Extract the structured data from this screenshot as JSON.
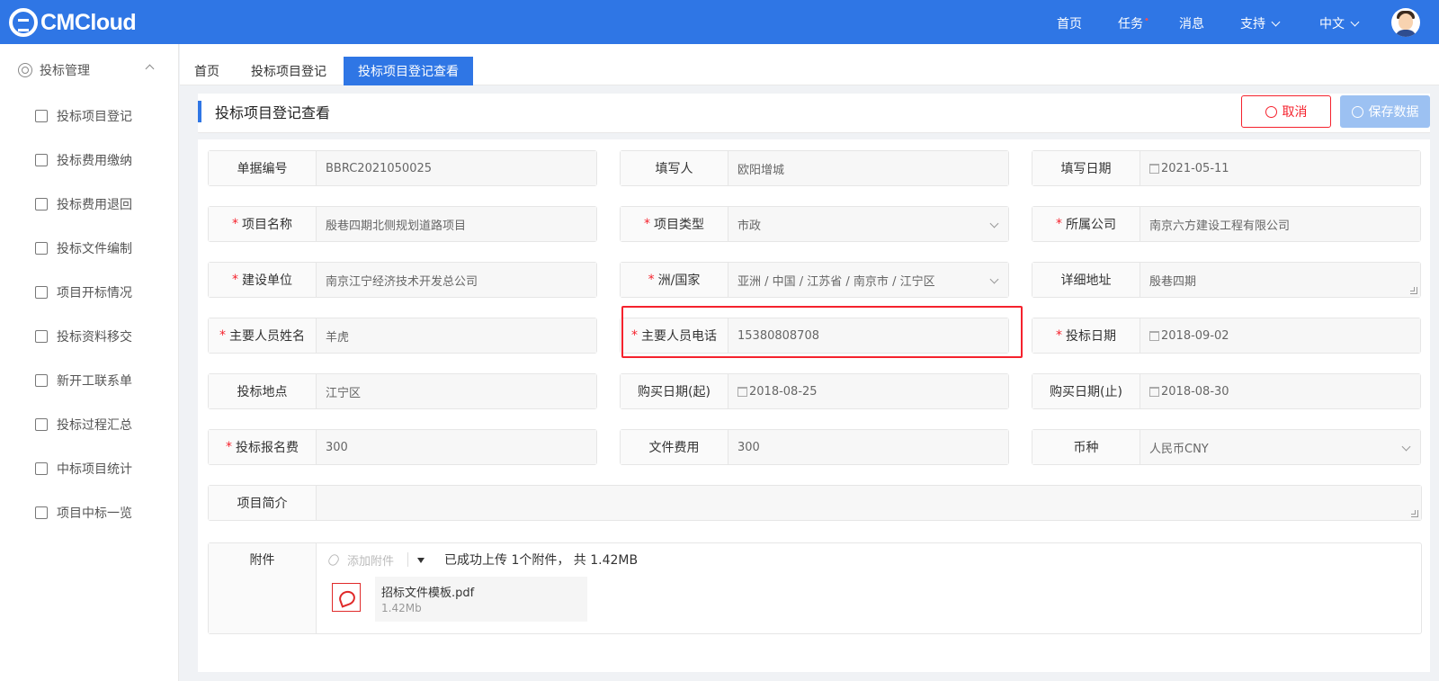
{
  "app": {
    "logo_text": "CMCloud"
  },
  "topnav": {
    "home": "首页",
    "tasks": "任务",
    "tasks_dot": "•",
    "messages": "消息",
    "support": "支持",
    "language": "中文"
  },
  "sidebar": {
    "group": "投标管理",
    "items": [
      {
        "label": "投标项目登记",
        "icon": "layers-icon"
      },
      {
        "label": "投标费用缴纳",
        "icon": "cube-icon"
      },
      {
        "label": "投标费用退回",
        "icon": "coins-icon"
      },
      {
        "label": "投标文件编制",
        "icon": "clipboard-icon"
      },
      {
        "label": "项目开标情况",
        "icon": "globe-icon"
      },
      {
        "label": "投标资料移交",
        "icon": "share-icon"
      },
      {
        "label": "新开工联系单",
        "icon": "building-icon"
      },
      {
        "label": "投标过程汇总",
        "icon": "edit-doc-icon"
      },
      {
        "label": "中标项目统计",
        "icon": "hexagon-icon"
      },
      {
        "label": "项目中标一览",
        "icon": "doc-list-icon"
      }
    ]
  },
  "tabs": [
    {
      "label": "首页",
      "active": false
    },
    {
      "label": "投标项目登记",
      "active": false
    },
    {
      "label": "投标项目登记查看",
      "active": true
    }
  ],
  "page": {
    "title": "投标项目登记查看",
    "cancel_label": "取消",
    "save_label": "保存数据"
  },
  "form": {
    "doc_no": {
      "label": "单据编号",
      "value": "BBRC2021050025"
    },
    "filler": {
      "label": "填写人",
      "value": "欧阳增城"
    },
    "fill_date": {
      "label": "填写日期",
      "value": "2021-05-11"
    },
    "project_name": {
      "label": "项目名称",
      "value": "殷巷四期北侧规划道路项目"
    },
    "project_type": {
      "label": "项目类型",
      "value": "市政"
    },
    "company": {
      "label": "所属公司",
      "value": "南京六方建设工程有限公司"
    },
    "builder": {
      "label": "建设单位",
      "value": "南京江宁经济技术开发总公司"
    },
    "region": {
      "label": "洲/国家",
      "value": "亚洲 / 中国 / 江苏省 / 南京市 / 江宁区"
    },
    "address": {
      "label": "详细地址",
      "value": "殷巷四期"
    },
    "contact_name": {
      "label": "主要人员姓名",
      "value": "羊虎"
    },
    "contact_phone": {
      "label": "主要人员电话",
      "value": "15380808708"
    },
    "bid_date": {
      "label": "投标日期",
      "value": "2018-09-02"
    },
    "bid_place": {
      "label": "投标地点",
      "value": "江宁区"
    },
    "buy_start": {
      "label": "购买日期(起)",
      "value": "2018-08-25"
    },
    "buy_end": {
      "label": "购买日期(止)",
      "value": "2018-08-30"
    },
    "reg_fee": {
      "label": "投标报名费",
      "value": "300"
    },
    "doc_fee": {
      "label": "文件费用",
      "value": "300"
    },
    "currency": {
      "label": "币种",
      "value": "人民币CNY"
    },
    "intro": {
      "label": "项目简介",
      "value": ""
    },
    "attachments": {
      "label": "附件",
      "add_label": "添加附件",
      "status": "已成功上传 1个附件， 共 1.42MB",
      "files": [
        {
          "name": "招标文件模板.pdf",
          "size": "1.42Mb"
        }
      ]
    }
  },
  "colors": {
    "brand": "#2f76e5",
    "required": "#f5222d",
    "highlight": "#f5222d"
  }
}
